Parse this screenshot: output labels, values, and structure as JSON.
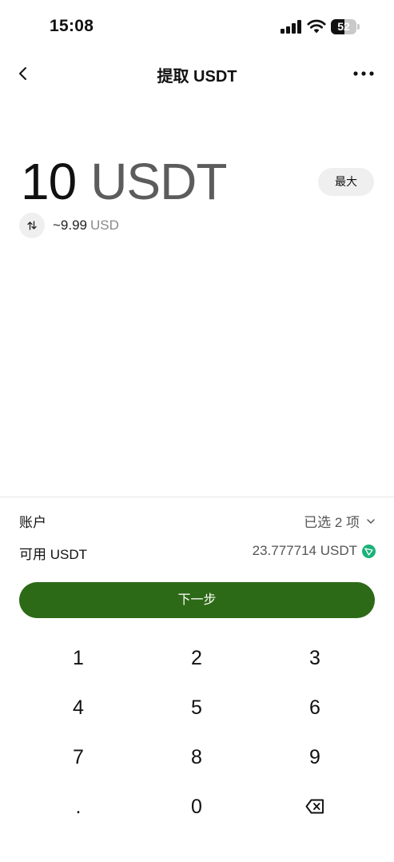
{
  "status_bar": {
    "time": "15:08",
    "battery": "52",
    "battery_level": 0.52
  },
  "header": {
    "title": "提取 USDT",
    "back_icon": "chevron-left-icon",
    "more_icon": "ellipsis-icon"
  },
  "amount": {
    "value": "10",
    "unit": "USDT",
    "max_label": "最大"
  },
  "conversion": {
    "value": "~9.99",
    "unit": "USD",
    "icon": "swap-arrows-icon"
  },
  "account_row": {
    "label": "账户",
    "value": "已选 2 项"
  },
  "available_row": {
    "label": "可用 USDT",
    "value": "23.777714 USDT",
    "icon": "tron-icon"
  },
  "next_button": {
    "label": "下一步"
  },
  "keypad": {
    "keys": [
      "1",
      "2",
      "3",
      "4",
      "5",
      "6",
      "7",
      "8",
      "9",
      ".",
      "0"
    ],
    "backspace_icon": "backspace-icon"
  },
  "colors": {
    "primary": "#2d6a17",
    "tron": "#1bb17a",
    "muted_bg": "#efefef"
  }
}
